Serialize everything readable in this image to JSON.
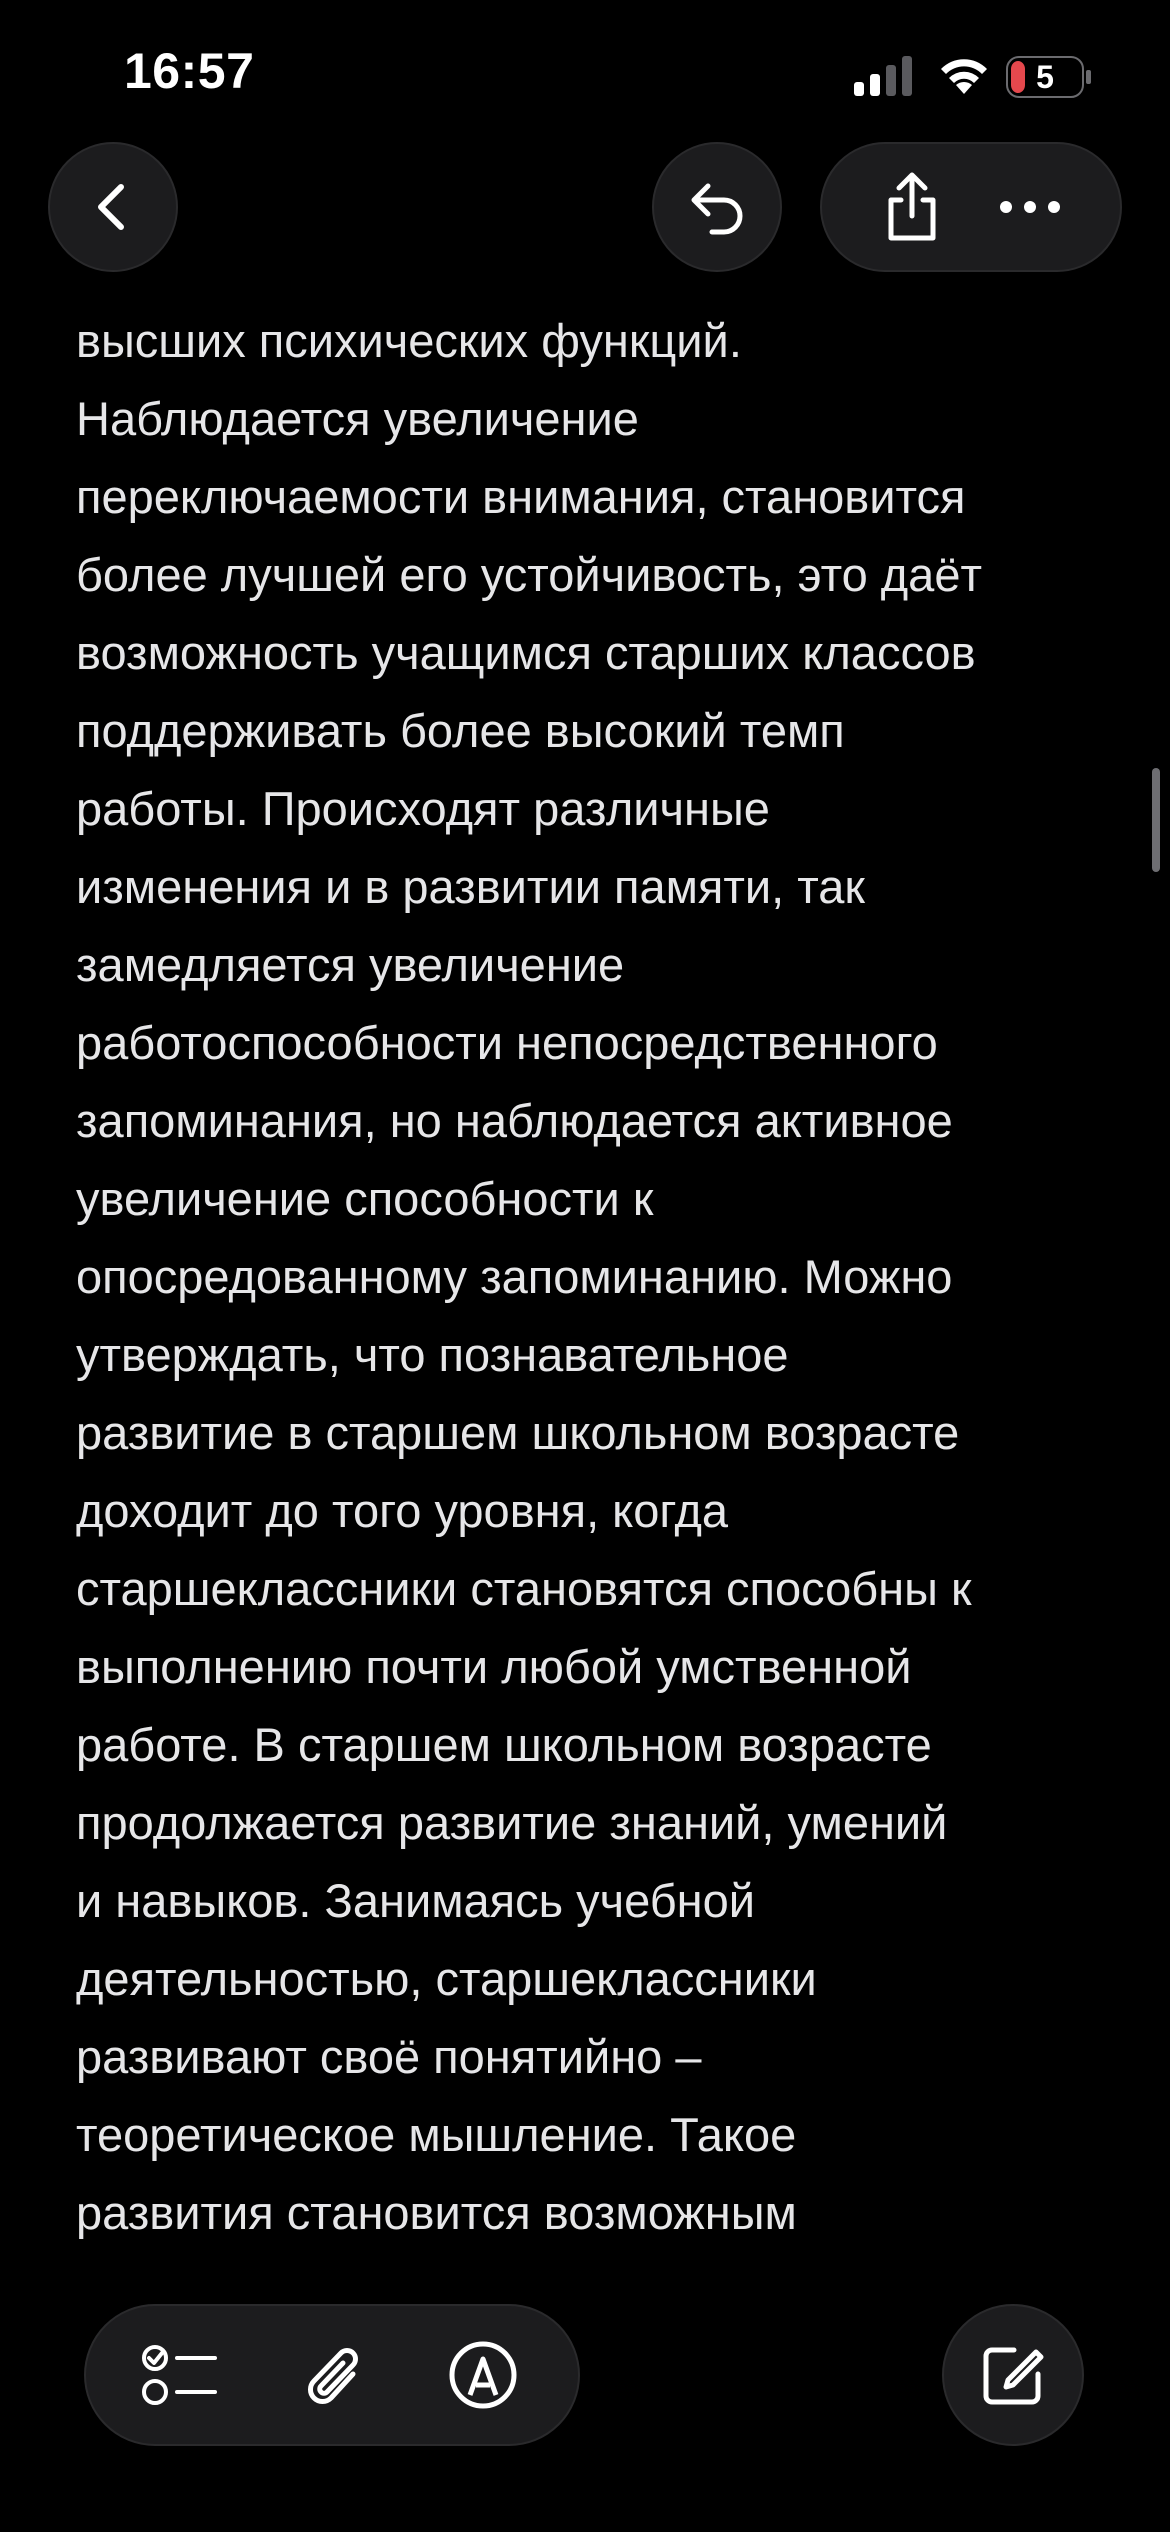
{
  "status_bar": {
    "time": "16:57",
    "battery_level": "5",
    "battery_color": "#e5484d",
    "signal_icon": "cellular-signal-icon",
    "wifi_icon": "wifi-icon"
  },
  "toolbar_top": {
    "back_icon": "chevron-left-icon",
    "undo_icon": "undo-icon",
    "share_icon": "share-icon",
    "more_icon": "ellipsis-icon"
  },
  "note": {
    "lines": [
      "высших психических функций.",
      "Наблюдается увеличение",
      "переключаемости внимания, становится",
      "более лучшей его устойчивость, это даёт",
      "возможность учащимся старших классов",
      "поддерживать более высокий темп",
      "работы. Происходят различные",
      "изменения и в развитии памяти, так",
      "замедляется увеличение",
      "работоспособности непосредственного",
      "запоминания, но наблюдается активное",
      "увеличение способности к",
      "опосредованному запоминанию. Можно",
      "утверждать, что познавательное",
      "развитие в старшем школьном возрасте",
      "доходит до того уровня, когда",
      "старшеклассники становятся способны к",
      "выполнению почти любой умственной",
      "работе. В старшем школьном возрасте",
      "продолжается развитие знаний, умений",
      "и навыков. Занимаясь учебной",
      "деятельностью, старшеклассники",
      "развивают своё понятийно –",
      "теоретическое мышление. Такое",
      "развития становится возможным"
    ]
  },
  "toolbar_bottom": {
    "checklist_icon": "checklist-icon",
    "attachment_icon": "paperclip-icon",
    "markup_icon": "markup-pen-icon",
    "compose_icon": "compose-icon"
  },
  "colors": {
    "background": "#000000",
    "button_fill": "#1c1c1e",
    "text": "#e6e6e8"
  }
}
